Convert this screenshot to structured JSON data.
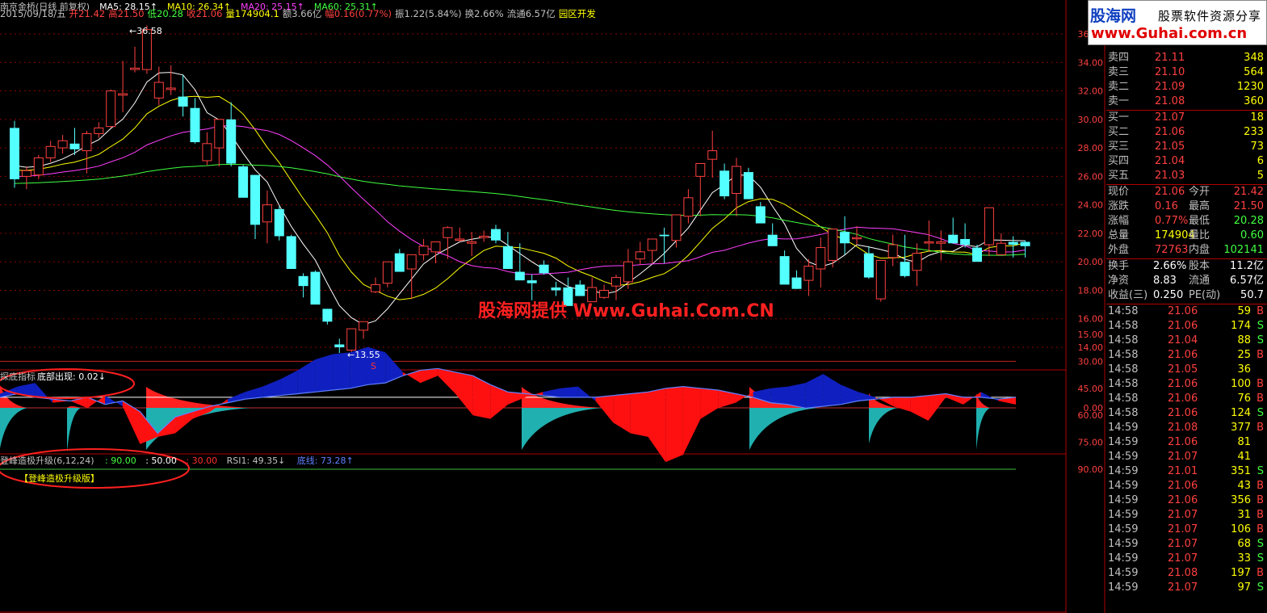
{
  "header": {
    "line1": [
      {
        "text": "南京金桥(日线 前复权)",
        "color": "#c0c0c0"
      },
      {
        "text": "MA5: 28.15↑",
        "color": "#ffffff"
      },
      {
        "text": "MA10: 26.34↑",
        "color": "#ffff00"
      },
      {
        "text": "MA20: 25.15↑",
        "color": "#ff40ff"
      },
      {
        "text": "MA60: 25.31↑",
        "color": "#40ff40"
      }
    ],
    "line2": [
      {
        "text": "2015/09/18/五",
        "color": "#c0c0c0"
      },
      {
        "text": "开21.42",
        "color": "#ff4040"
      },
      {
        "text": "高21.50",
        "color": "#ff4040"
      },
      {
        "text": "低20.28",
        "color": "#40ff40"
      },
      {
        "text": "收21.06",
        "color": "#ff4040"
      },
      {
        "text": "量174904.1",
        "color": "#ffff00"
      },
      {
        "text": "额3.66亿",
        "color": "#c0c0c0"
      },
      {
        "text": "幅0.16(0.77%)",
        "color": "#ff4040"
      },
      {
        "text": "振1.22(5.84%)",
        "color": "#c0c0c0"
      },
      {
        "text": "换2.66%",
        "color": "#c0c0c0"
      },
      {
        "text": "流通6.57亿",
        "color": "#c0c0c0"
      },
      {
        "text": "园区开发",
        "color": "#ffff00"
      }
    ]
  },
  "price_axis": [
    "36.00",
    "34.00",
    "32.00",
    "30.00",
    "28.00",
    "26.00",
    "24.00",
    "22.00",
    "20.00",
    "18.00",
    "16.00",
    "14.00"
  ],
  "annotations": {
    "high_label": "36.58",
    "low_label": "13.55",
    "low_marker": "S"
  },
  "watermark": "股海网提供 Www.Guhai.Com.CN",
  "indicator1": {
    "title": "探底指标",
    "label": "底部出现: 0.02↓",
    "axis": "0.00"
  },
  "indicator2": {
    "title": "登峰造极升级(6,12,24)",
    "params": [
      {
        "text": ": 90.00",
        "color": "#40ff40"
      },
      {
        "text": ": 50.00",
        "color": "#ffffff"
      },
      {
        "text": ": 30.00",
        "color": "#ff3030"
      },
      {
        "text": "RSI1: 49.35↓",
        "color": "#c0c0c0"
      },
      {
        "text": "底线: 73.28↑",
        "color": "#6080ff"
      }
    ],
    "badge": "【登峰造极升级版】",
    "axis": [
      "90.00",
      "75.00",
      "60.00",
      "45.00",
      "30.00",
      "15.00"
    ]
  },
  "logo": {
    "name": "股海网",
    "tagline": "股票软件资源分享",
    "url": "www.Guhai.com.cn"
  },
  "order_book": {
    "sells": [
      {
        "label": "卖四",
        "price": "21.11",
        "vol": "348"
      },
      {
        "label": "卖三",
        "price": "21.10",
        "vol": "564"
      },
      {
        "label": "卖二",
        "price": "21.09",
        "vol": "1230"
      },
      {
        "label": "卖一",
        "price": "21.08",
        "vol": "360"
      }
    ],
    "buys": [
      {
        "label": "买一",
        "price": "21.07",
        "vol": "18"
      },
      {
        "label": "买二",
        "price": "21.06",
        "vol": "233"
      },
      {
        "label": "买三",
        "price": "21.05",
        "vol": "73"
      },
      {
        "label": "买四",
        "price": "21.04",
        "vol": "6"
      },
      {
        "label": "买五",
        "price": "21.03",
        "vol": "5"
      }
    ]
  },
  "quote": [
    {
      "l1": "现价",
      "v1": "21.06",
      "c1": "#ff4040",
      "l2": "今开",
      "v2": "21.42",
      "c2": "#ff4040"
    },
    {
      "l1": "涨跌",
      "v1": "0.16",
      "c1": "#ff4040",
      "l2": "最高",
      "v2": "21.50",
      "c2": "#ff4040"
    },
    {
      "l1": "涨幅",
      "v1": "0.77%",
      "c1": "#ff4040",
      "l2": "最低",
      "v2": "20.28",
      "c2": "#40ff40"
    },
    {
      "l1": "总量",
      "v1": "174904",
      "c1": "#ffff00",
      "l2": "量比",
      "v2": "0.60",
      "c2": "#40ff40"
    },
    {
      "l1": "外盘",
      "v1": "72763",
      "c1": "#ff4040",
      "l2": "内盘",
      "v2": "102141",
      "c2": "#40ff40"
    }
  ],
  "stats": [
    {
      "l1": "换手",
      "v1": "2.66%",
      "l2": "股本",
      "v2": "11.2亿"
    },
    {
      "l1": "净资",
      "v1": "8.83",
      "l2": "流通",
      "v2": "6.57亿"
    },
    {
      "l1": "收益(三)",
      "v1": "0.250",
      "l2": "PE(动)",
      "v2": "50.7"
    }
  ],
  "ticks": [
    {
      "time": "14:58",
      "price": "21.06",
      "vol": "59",
      "bs": "B"
    },
    {
      "time": "14:58",
      "price": "21.06",
      "vol": "174",
      "bs": "S"
    },
    {
      "time": "14:58",
      "price": "21.04",
      "vol": "88",
      "bs": "S"
    },
    {
      "time": "14:58",
      "price": "21.06",
      "vol": "25",
      "bs": "B"
    },
    {
      "time": "14:58",
      "price": "21.05",
      "vol": "36",
      "bs": ""
    },
    {
      "time": "14:58",
      "price": "21.06",
      "vol": "100",
      "bs": "B"
    },
    {
      "time": "14:58",
      "price": "21.06",
      "vol": "76",
      "bs": "B"
    },
    {
      "time": "14:58",
      "price": "21.06",
      "vol": "124",
      "bs": "S"
    },
    {
      "time": "14:59",
      "price": "21.08",
      "vol": "377",
      "bs": "B"
    },
    {
      "time": "14:59",
      "price": "21.06",
      "vol": "81",
      "bs": ""
    },
    {
      "time": "14:59",
      "price": "21.07",
      "vol": "41",
      "bs": ""
    },
    {
      "time": "14:59",
      "price": "21.01",
      "vol": "351",
      "bs": "S"
    },
    {
      "time": "14:59",
      "price": "21.06",
      "vol": "43",
      "bs": "B"
    },
    {
      "time": "14:59",
      "price": "21.06",
      "vol": "356",
      "bs": "B"
    },
    {
      "time": "14:59",
      "price": "21.07",
      "vol": "31",
      "bs": "B"
    },
    {
      "time": "14:59",
      "price": "21.07",
      "vol": "106",
      "bs": "B"
    },
    {
      "time": "14:59",
      "price": "21.07",
      "vol": "68",
      "bs": "S"
    },
    {
      "time": "14:59",
      "price": "21.07",
      "vol": "33",
      "bs": "S"
    },
    {
      "time": "14:59",
      "price": "21.08",
      "vol": "197",
      "bs": "B"
    },
    {
      "time": "14:59",
      "price": "21.07",
      "vol": "97",
      "bs": "S"
    }
  ],
  "colors": {
    "up": "#ff4040",
    "down": "#54ffff",
    "grid": "#8b0000",
    "ma5": "#ffffff",
    "ma10": "#ffff00",
    "ma20": "#ff40ff",
    "ma60": "#40ff40"
  },
  "chart_data": {
    "type": "candlestick",
    "candles_ohlc": [
      [
        29.4,
        29.9,
        25.2,
        25.8
      ],
      [
        26.0,
        26.7,
        25.1,
        26.4
      ],
      [
        26.1,
        27.5,
        25.8,
        27.3
      ],
      [
        27.3,
        28.5,
        27.0,
        28.1
      ],
      [
        28.0,
        28.9,
        27.6,
        28.5
      ],
      [
        28.3,
        29.4,
        27.5,
        27.9
      ],
      [
        27.8,
        29.2,
        26.2,
        29.0
      ],
      [
        29.0,
        29.8,
        28.7,
        29.4
      ],
      [
        29.5,
        32.1,
        29.4,
        32.0
      ],
      [
        31.7,
        34.1,
        30.5,
        31.8
      ],
      [
        33.5,
        35.1,
        33.3,
        33.6
      ],
      [
        33.5,
        36.6,
        33.2,
        36.3
      ],
      [
        31.5,
        33.7,
        31.0,
        32.6
      ],
      [
        32.1,
        33.8,
        31.7,
        32.2
      ],
      [
        31.6,
        33.1,
        30.2,
        30.9
      ],
      [
        30.8,
        31.5,
        28.3,
        28.4
      ],
      [
        27.1,
        29.1,
        26.8,
        28.3
      ],
      [
        28.0,
        29.6,
        26.7,
        30.0
      ],
      [
        30.0,
        31.2,
        26.7,
        26.9
      ],
      [
        26.7,
        26.8,
        24.7,
        24.5
      ],
      [
        26.1,
        26.1,
        21.6,
        22.6
      ],
      [
        22.8,
        25.0,
        21.3,
        24.0
      ],
      [
        23.7,
        23.9,
        21.5,
        21.8
      ],
      [
        21.8,
        21.9,
        19.5,
        19.5
      ],
      [
        19.0,
        19.2,
        17.5,
        18.3
      ],
      [
        19.3,
        19.4,
        17.2,
        17.0
      ],
      [
        16.7,
        16.7,
        15.6,
        15.8
      ],
      [
        14.2,
        14.6,
        13.6,
        14.0
      ],
      [
        13.8,
        15.1,
        13.5,
        15.3
      ],
      [
        15.2,
        15.8,
        14.6,
        15.8
      ],
      [
        17.9,
        18.9,
        17.8,
        18.4
      ],
      [
        18.5,
        20.0,
        18.2,
        20.0
      ],
      [
        20.6,
        20.9,
        19.4,
        19.3
      ],
      [
        19.5,
        20.5,
        17.4,
        20.5
      ],
      [
        20.5,
        21.6,
        20.1,
        21.1
      ],
      [
        20.7,
        21.3,
        19.9,
        21.4
      ],
      [
        21.7,
        22.5,
        20.2,
        22.4
      ],
      [
        21.6,
        22.4,
        21.4,
        21.6
      ],
      [
        21.3,
        22.1,
        20.4,
        21.4
      ],
      [
        21.7,
        22.2,
        21.4,
        21.8
      ],
      [
        22.3,
        22.6,
        21.3,
        21.5
      ],
      [
        21.1,
        22.1,
        19.5,
        19.5
      ],
      [
        19.3,
        21.3,
        18.7,
        18.7
      ],
      [
        18.7,
        19.1,
        17.3,
        18.5
      ],
      [
        19.8,
        20.1,
        19.1,
        19.2
      ],
      [
        18.2,
        18.6,
        17.6,
        18.0
      ],
      [
        18.2,
        18.9,
        17.3,
        16.9
      ],
      [
        18.4,
        18.7,
        17.7,
        17.6
      ],
      [
        17.2,
        18.9,
        17.2,
        18.2
      ],
      [
        17.5,
        18.4,
        17.4,
        18.0
      ],
      [
        18.3,
        19.1,
        17.3,
        18.9
      ],
      [
        18.6,
        20.9,
        18.1,
        20.0
      ],
      [
        20.2,
        21.4,
        19.8,
        20.7
      ],
      [
        20.8,
        21.6,
        19.9,
        21.6
      ],
      [
        21.9,
        22.4,
        19.9,
        21.8
      ],
      [
        21.5,
        22.8,
        21.0,
        23.3
      ],
      [
        23.2,
        25.1,
        22.7,
        24.5
      ],
      [
        26.0,
        26.9,
        23.2,
        26.9
      ],
      [
        27.2,
        29.2,
        25.9,
        27.8
      ],
      [
        26.4,
        26.9,
        24.4,
        24.6
      ],
      [
        24.8,
        27.3,
        23.2,
        26.7
      ],
      [
        26.3,
        26.6,
        24.4,
        24.4
      ],
      [
        23.9,
        24.2,
        22.8,
        22.7
      ],
      [
        21.9,
        22.7,
        21.1,
        21.1
      ],
      [
        20.4,
        20.8,
        19.5,
        18.4
      ],
      [
        18.9,
        19.4,
        18.1,
        18.1
      ],
      [
        18.7,
        20.2,
        17.6,
        19.7
      ],
      [
        19.5,
        21.7,
        18.2,
        21.0
      ],
      [
        20.1,
        21.6,
        19.6,
        22.3
      ],
      [
        22.1,
        23.2,
        20.5,
        21.3
      ],
      [
        21.7,
        22.5,
        21.2,
        21.7
      ],
      [
        20.6,
        21.1,
        18.8,
        18.9
      ],
      [
        17.4,
        20.1,
        17.2,
        20.1
      ],
      [
        20.3,
        21.9,
        19.7,
        21.2
      ],
      [
        20.0,
        21.9,
        18.9,
        19.0
      ],
      [
        19.4,
        21.3,
        18.3,
        20.6
      ],
      [
        21.4,
        22.9,
        20.7,
        21.4
      ],
      [
        21.3,
        22.2,
        20.1,
        21.4
      ],
      [
        21.9,
        23.1,
        21.4,
        21.3
      ],
      [
        21.6,
        22.7,
        21.0,
        21.2
      ],
      [
        21.0,
        21.2,
        20.2,
        20.0
      ],
      [
        21.2,
        23.7,
        20.4,
        23.8
      ],
      [
        20.5,
        22.0,
        20.6,
        21.3
      ],
      [
        21.4,
        21.8,
        20.3,
        21.2
      ],
      [
        21.4,
        21.5,
        20.3,
        21.1
      ]
    ],
    "xlabel": "",
    "ylabel": "",
    "ylim": [
      13,
      37
    ]
  }
}
